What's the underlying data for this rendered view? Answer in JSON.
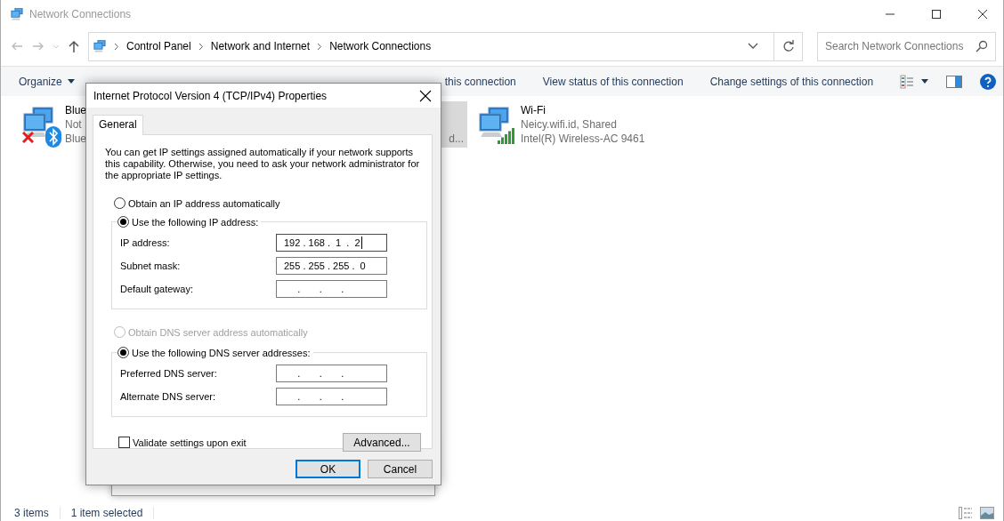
{
  "explorer": {
    "title": "Network Connections",
    "breadcrumb": [
      "Control Panel",
      "Network and Internet",
      "Network Connections"
    ],
    "search": {
      "placeholder": "Search Network Connections"
    },
    "toolbar": [
      {
        "label": "Organize",
        "kind": "menu"
      },
      {
        "label": "this connection",
        "kind": "covered"
      },
      {
        "label": "View status of this connection",
        "kind": "command"
      },
      {
        "label": "Change settings of this connection",
        "kind": "command"
      }
    ],
    "connections": [
      {
        "kind": "bluetooth",
        "name": "Blue",
        "status": "Not",
        "device": "Blue",
        "selected": false
      },
      {
        "kind": "covered",
        "device": "d...",
        "selected": true
      },
      {
        "kind": "wifi",
        "name": "Wi-Fi",
        "status": "Neicy.wifi.id, Shared",
        "device": "Intel(R) Wireless-AC 9461",
        "selected": false
      }
    ],
    "status_bar": [
      "3 items",
      "1 item selected"
    ]
  },
  "dialog": {
    "title": "Internet Protocol Version 4 (TCP/IPv4) Properties",
    "tabs": [
      {
        "label": "General",
        "selected": true
      }
    ],
    "description": "You can get IP settings assigned automatically if your network supports this capability. Otherwise, you need to ask your network administrator for the appropriate IP settings.",
    "ip_options": [
      {
        "label": "Obtain an IP address automatically",
        "selected": false,
        "disabled": false
      },
      {
        "label": "Use the following IP address:",
        "selected": true,
        "disabled": false
      }
    ],
    "ip_fields": [
      {
        "label": "IP address:",
        "value": "192 . 168 .  1  .  2",
        "focused": true
      },
      {
        "label": "Subnet mask:",
        "value": "255 . 255 . 255 .  0",
        "focused": false
      },
      {
        "label": "Default gateway:",
        "value": "     .       .       .     ",
        "focused": false
      }
    ],
    "dns_options": [
      {
        "label": "Obtain DNS server address automatically",
        "selected": false,
        "disabled": true
      },
      {
        "label": "Use the following DNS server addresses:",
        "selected": true,
        "disabled": false
      }
    ],
    "dns_fields": [
      {
        "label": "Preferred DNS server:",
        "value": "     .       .       .     ",
        "focused": false
      },
      {
        "label": "Alternate DNS server:",
        "value": "     .       .       .     ",
        "focused": false
      }
    ],
    "validate": {
      "label": "Validate settings upon exit",
      "checked": false
    },
    "advanced_button": "Advanced...",
    "buttons": [
      {
        "label": "OK",
        "default": true
      },
      {
        "label": "Cancel",
        "default": false
      }
    ]
  }
}
